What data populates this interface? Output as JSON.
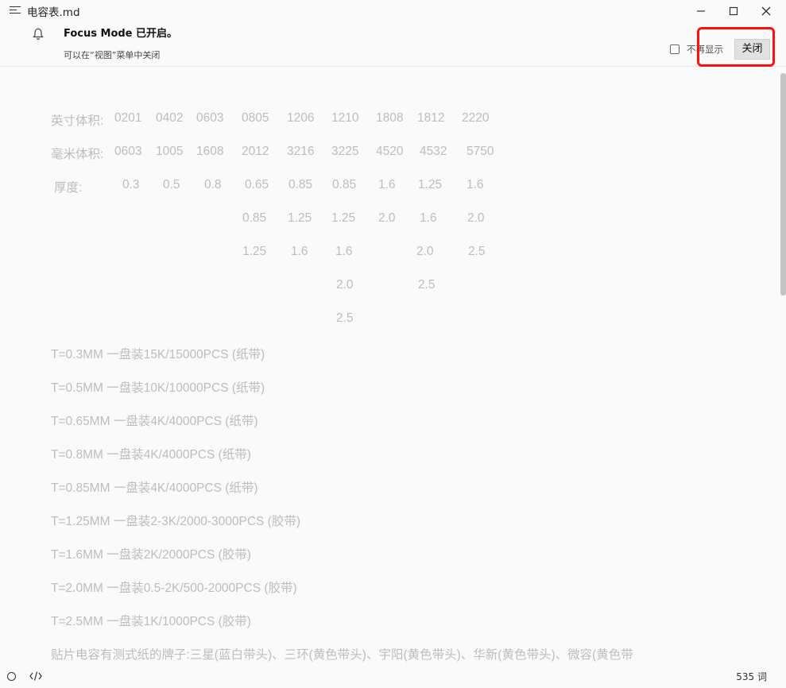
{
  "window": {
    "title": "电容表.md"
  },
  "notice": {
    "title": "Focus Mode 已开启。",
    "subtitle": "可以在“视图”菜单中关闭",
    "dont_show_label": "不再显示",
    "close_label": "关闭"
  },
  "table": {
    "inch_label": "英寸体积:",
    "inch_values": [
      "0201",
      "0402",
      "0603",
      "0805",
      "1206",
      "1210",
      "1808",
      "1812",
      "2220"
    ],
    "mm_label": "毫米体积:",
    "mm_values": [
      "0603",
      "1005",
      "1608",
      "2012",
      "3216",
      "3225",
      "4520",
      "4532",
      "5750"
    ],
    "thickness_label": "厚度:",
    "thickness_row1": [
      "0.3",
      "0.5",
      "0.8",
      "0.65",
      "0.85",
      "0.85",
      "1.6",
      "1.25",
      "1.6"
    ],
    "thickness_row2": [
      "0.85",
      "1.25",
      "1.25",
      "2.0",
      "1.6",
      "2.0"
    ],
    "thickness_row3": [
      "1.25",
      "1.6",
      "1.6",
      "2.0",
      "2.5"
    ],
    "thickness_row4": [
      "2.0",
      "2.5"
    ],
    "thickness_row5": [
      "2.5"
    ]
  },
  "packaging": [
    "T=0.3MM   一盘装15K/15000PCS (纸带)",
    "T=0.5MM   一盘装10K/10000PCS (纸带)",
    "T=0.65MM  一盘装4K/4000PCS (纸带)",
    "T=0.8MM   一盘装4K/4000PCS (纸带)",
    "T=0.85MM   一盘装4K/4000PCS (纸带)",
    "T=1.25MM   一盘装2-3K/2000-3000PCS (胶带)",
    "T=1.6MM   一盘装2K/2000PCS (胶带)",
    "T=2.0MM   一盘装0.5-2K/500-2000PCS (胶带)",
    "T=2.5MM   一盘装1K/1000PCS (胶带)"
  ],
  "brands_line": "贴片电容有测式纸的牌子:三星(蓝白带头)、三环(黄色带头)、宇阳(黄色带头)、华新(黄色带头)、微容(黄色带",
  "status": {
    "word_count": "535 词"
  },
  "colors": {
    "highlight": "#ff1010",
    "text_faded": "#bdbdbd"
  }
}
